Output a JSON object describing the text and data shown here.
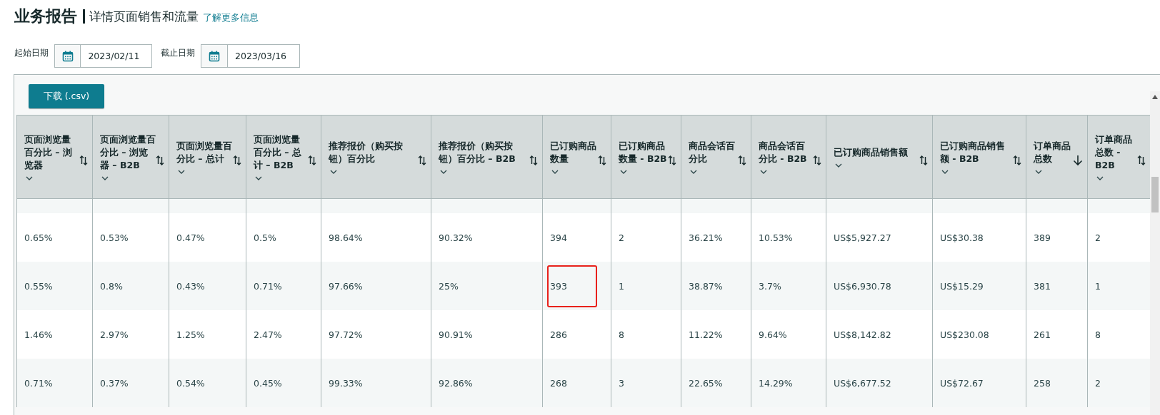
{
  "header": {
    "title": "业务报告",
    "subtitle": "详情页面销售和流量",
    "link": "了解更多信息"
  },
  "dates": [
    {
      "label": "起始日期",
      "value": "2023/02/11"
    },
    {
      "label": "截止日期",
      "value": "2023/03/16"
    }
  ],
  "download_button": "下载 (.csv)",
  "table": {
    "columns": [
      {
        "label": "页面浏览量百分比 – 浏览器",
        "sorted": false
      },
      {
        "label": "页面浏览量百分比 – 浏览器 – B2B",
        "sorted": false
      },
      {
        "label": "页面浏览量百分比 – 总计",
        "sorted": false
      },
      {
        "label": "页面浏览量百分比 – 总计 – B2B",
        "sorted": false
      },
      {
        "label": "推荐报价（购买按钮）百分比",
        "sorted": false
      },
      {
        "label": "推荐报价（购买按钮）百分比 – B2B",
        "sorted": false
      },
      {
        "label": "已订购商品数量",
        "sorted": false
      },
      {
        "label": "已订购商品数量 - B2B",
        "sorted": false
      },
      {
        "label": "商品会话百分比",
        "sorted": false
      },
      {
        "label": "商品会话百分比 - B2B",
        "sorted": false
      },
      {
        "label": "已订购商品销售额",
        "sorted": false
      },
      {
        "label": "已订购商品销售额 - B2B",
        "sorted": false
      },
      {
        "label": "订单商品总数",
        "sorted": true
      },
      {
        "label": "订单商品总数 - B2B",
        "sorted": false
      }
    ],
    "rows": [
      {
        "cells": [
          {
            "text": "0.65%",
            "marked": false
          },
          {
            "text": "0.53%",
            "marked": false
          },
          {
            "text": "0.47%",
            "marked": false
          },
          {
            "text": "0.5%",
            "marked": false
          },
          {
            "text": "98.64%",
            "marked": false
          },
          {
            "text": "90.32%",
            "marked": false
          },
          {
            "text": "394",
            "marked": false
          },
          {
            "text": "2",
            "marked": false
          },
          {
            "text": "36.21%",
            "marked": false
          },
          {
            "text": "10.53%",
            "marked": false
          },
          {
            "text": "US$5,927.27",
            "marked": false
          },
          {
            "text": "US$30.38",
            "marked": false
          },
          {
            "text": "389",
            "marked": false
          },
          {
            "text": "2",
            "marked": false
          }
        ]
      },
      {
        "cells": [
          {
            "text": "0.55%",
            "marked": false
          },
          {
            "text": "0.8%",
            "marked": false
          },
          {
            "text": "0.43%",
            "marked": false
          },
          {
            "text": "0.71%",
            "marked": false
          },
          {
            "text": "97.66%",
            "marked": false
          },
          {
            "text": "25%",
            "marked": false
          },
          {
            "text": "393",
            "marked": true
          },
          {
            "text": "1",
            "marked": false
          },
          {
            "text": "38.87%",
            "marked": false
          },
          {
            "text": "3.7%",
            "marked": false
          },
          {
            "text": "US$6,930.78",
            "marked": false
          },
          {
            "text": "US$15.29",
            "marked": false
          },
          {
            "text": "381",
            "marked": false
          },
          {
            "text": "1",
            "marked": false
          }
        ]
      },
      {
        "cells": [
          {
            "text": "1.46%",
            "marked": false
          },
          {
            "text": "2.97%",
            "marked": false
          },
          {
            "text": "1.25%",
            "marked": false
          },
          {
            "text": "2.47%",
            "marked": false
          },
          {
            "text": "97.72%",
            "marked": false
          },
          {
            "text": "90.91%",
            "marked": false
          },
          {
            "text": "286",
            "marked": false
          },
          {
            "text": "8",
            "marked": false
          },
          {
            "text": "11.22%",
            "marked": false
          },
          {
            "text": "9.64%",
            "marked": false
          },
          {
            "text": "US$8,142.82",
            "marked": false
          },
          {
            "text": "US$230.08",
            "marked": false
          },
          {
            "text": "261",
            "marked": false
          },
          {
            "text": "8",
            "marked": false
          }
        ]
      },
      {
        "cells": [
          {
            "text": "0.71%",
            "marked": false
          },
          {
            "text": "0.37%",
            "marked": false
          },
          {
            "text": "0.54%",
            "marked": false
          },
          {
            "text": "0.45%",
            "marked": false
          },
          {
            "text": "99.33%",
            "marked": false
          },
          {
            "text": "92.86%",
            "marked": false
          },
          {
            "text": "268",
            "marked": false
          },
          {
            "text": "3",
            "marked": false
          },
          {
            "text": "22.65%",
            "marked": false
          },
          {
            "text": "14.29%",
            "marked": false
          },
          {
            "text": "US$6,677.52",
            "marked": false
          },
          {
            "text": "US$72.67",
            "marked": false
          },
          {
            "text": "258",
            "marked": false
          },
          {
            "text": "2",
            "marked": false
          }
        ]
      }
    ]
  }
}
